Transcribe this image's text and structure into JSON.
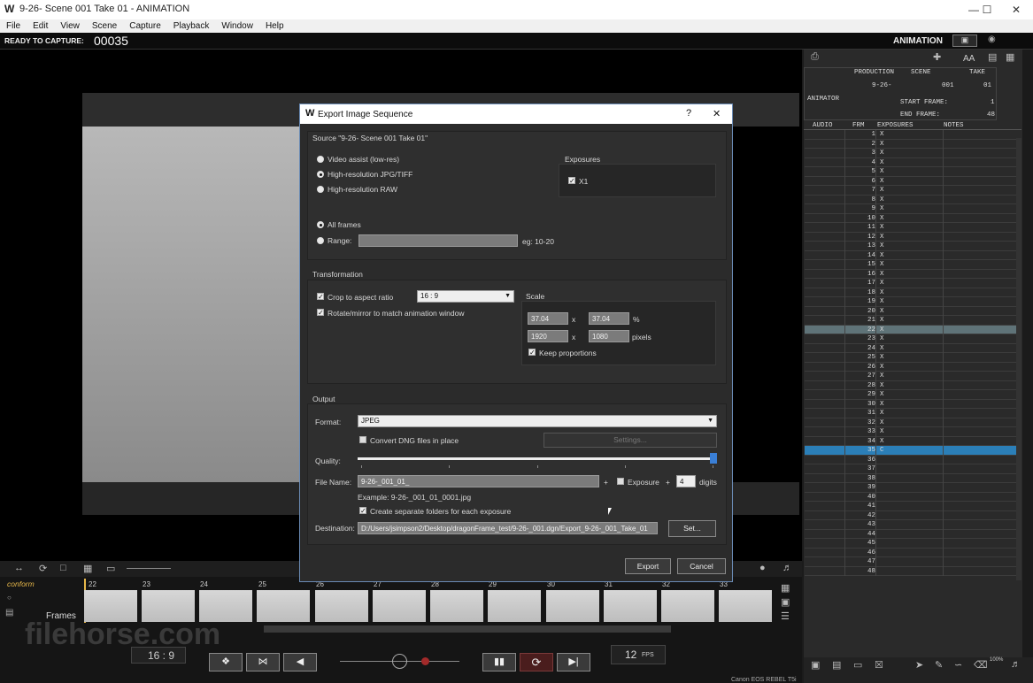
{
  "window": {
    "title": "9-26- Scene 001 Take 01 - ANIMATION",
    "logo": "W"
  },
  "menu": [
    "File",
    "Edit",
    "View",
    "Scene",
    "Capture",
    "Playback",
    "Window",
    "Help"
  ],
  "capture": {
    "label": "READY TO CAPTURE:",
    "frame": "00035",
    "mode": "ANIMATION"
  },
  "dialog": {
    "title": "Export Image Sequence",
    "help": "?",
    "close": "✕",
    "source_label": "Source \"9-26- Scene 001 Take 01\"",
    "source_options": [
      "Video assist (low-res)",
      "High-resolution JPG/TIFF",
      "High-resolution RAW"
    ],
    "source_selected": 1,
    "exposures_label": "Exposures",
    "exposure_item": "X1",
    "frames_options": [
      "All frames",
      "Range:"
    ],
    "range_hint": "eg: 10-20",
    "transformation_label": "Transformation",
    "crop_label": "Crop to aspect ratio",
    "aspect": "16 : 9",
    "rotate_label": "Rotate/mirror to match animation window",
    "scale_label": "Scale",
    "scale_w_pct": "37.04",
    "scale_h_pct": "37.04",
    "pct_unit": "%",
    "scale_w_px": "1920",
    "scale_h_px": "1080",
    "px_unit": "pixels",
    "times": "x",
    "keep_label": "Keep proportions",
    "output_label": "Output",
    "format_label": "Format:",
    "format_value": "JPEG",
    "convert_label": "Convert DNG files in place",
    "settings_label": "Settings...",
    "quality_label": "Quality:",
    "quality_value": 1.0,
    "filename_label": "File Name:",
    "filename_value": "9-26-_001_01_",
    "plus": "+",
    "exposure_label": "Exposure",
    "digits_value": "4",
    "digits_label": "digits",
    "example": "Example: 9-26-_001_01_0001.jpg",
    "folders_label": "Create separate folders for each exposure",
    "destination_label": "Destination:",
    "destination_value": "D:/Users/jsimpson2/Desktop/dragonFrame_test/9-26-_001.dgn/Export_9-26-_001_Take_01",
    "set_label": "Set...",
    "export_label": "Export",
    "cancel_label": "Cancel"
  },
  "xsheet": {
    "production_label": "PRODUCTION",
    "scene_label": "SCENE",
    "take_label": "TAKE",
    "production": "9-26-",
    "scene": "001",
    "take": "01",
    "animator_label": "ANIMATOR",
    "start_label": "START FRAME:",
    "start": "1",
    "end_label": "END FRAME:",
    "end": "48",
    "cols": [
      "AUDIO",
      "FRM",
      "EXPOSURES",
      "NOTES"
    ],
    "current_frame": 35,
    "highlight_frame": 22,
    "rows": [
      {
        "f": "1",
        "x": "X"
      },
      {
        "f": "2",
        "x": "X"
      },
      {
        "f": "3",
        "x": "X"
      },
      {
        "f": "4",
        "x": "X"
      },
      {
        "f": "5",
        "x": "X"
      },
      {
        "f": "6",
        "x": "X"
      },
      {
        "f": "7",
        "x": "X"
      },
      {
        "f": "8",
        "x": "X"
      },
      {
        "f": "9",
        "x": "X"
      },
      {
        "f": "10",
        "x": "X"
      },
      {
        "f": "11",
        "x": "X"
      },
      {
        "f": "12",
        "x": "X"
      },
      {
        "f": "13",
        "x": "X"
      },
      {
        "f": "14",
        "x": "X"
      },
      {
        "f": "15",
        "x": "X"
      },
      {
        "f": "16",
        "x": "X"
      },
      {
        "f": "17",
        "x": "X"
      },
      {
        "f": "18",
        "x": "X"
      },
      {
        "f": "19",
        "x": "X"
      },
      {
        "f": "20",
        "x": "X"
      },
      {
        "f": "21",
        "x": "X"
      },
      {
        "f": "22",
        "x": "X"
      },
      {
        "f": "23",
        "x": "X"
      },
      {
        "f": "24",
        "x": "X"
      },
      {
        "f": "25",
        "x": "X"
      },
      {
        "f": "26",
        "x": "X"
      },
      {
        "f": "27",
        "x": "X"
      },
      {
        "f": "28",
        "x": "X"
      },
      {
        "f": "29",
        "x": "X"
      },
      {
        "f": "30",
        "x": "X"
      },
      {
        "f": "31",
        "x": "X"
      },
      {
        "f": "32",
        "x": "X"
      },
      {
        "f": "33",
        "x": "X"
      },
      {
        "f": "34",
        "x": "X"
      },
      {
        "f": "35",
        "x": "C"
      },
      {
        "f": "36",
        "x": ""
      },
      {
        "f": "37",
        "x": ""
      },
      {
        "f": "38",
        "x": ""
      },
      {
        "f": "39",
        "x": ""
      },
      {
        "f": "40",
        "x": ""
      },
      {
        "f": "41",
        "x": ""
      },
      {
        "f": "42",
        "x": ""
      },
      {
        "f": "43",
        "x": ""
      },
      {
        "f": "44",
        "x": ""
      },
      {
        "f": "45",
        "x": ""
      },
      {
        "f": "46",
        "x": ""
      },
      {
        "f": "47",
        "x": ""
      },
      {
        "f": "48",
        "x": ""
      }
    ]
  },
  "timeline": {
    "conform": "conform",
    "frames_label": "Frames",
    "frame_numbers": [
      "22",
      "23",
      "24",
      "25",
      "26",
      "27",
      "28",
      "29",
      "30",
      "31",
      "32",
      "33"
    ]
  },
  "transport": {
    "aspect": "16 : 9",
    "fps": "12",
    "fps_unit": "FPS"
  },
  "zoom": "100%",
  "camera": "Canon EOS REBEL T5i",
  "watermark": "filehorse.com"
}
